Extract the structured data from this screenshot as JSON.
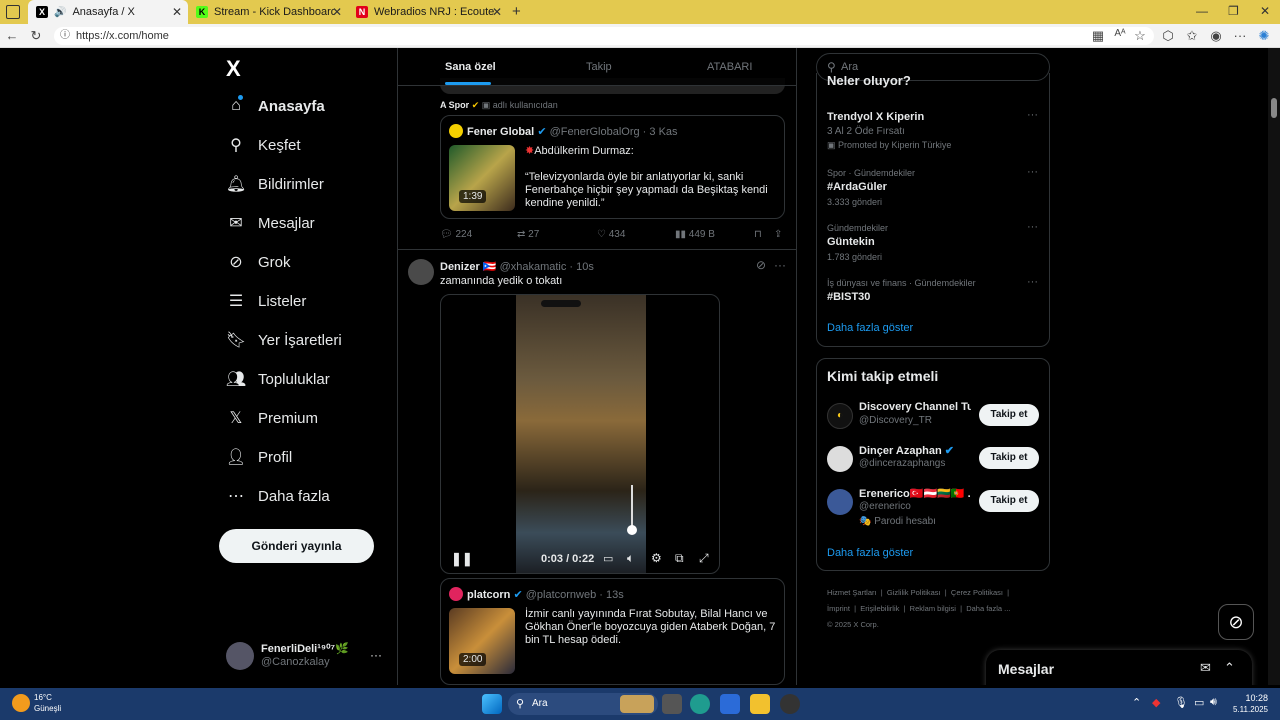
{
  "browser": {
    "tabs": [
      {
        "title": "Anasayfa / X",
        "fav": "X"
      },
      {
        "title": "Stream - Kick Dashboard",
        "fav": "K"
      },
      {
        "title": "Webradios NRJ : Ecoute en direct",
        "fav": "N"
      }
    ],
    "new_tab": "+",
    "url": "https://x.com/home"
  },
  "nav": {
    "logo": "X",
    "items": [
      "Anasayfa",
      "Keşfet",
      "Bildirimler",
      "Mesajlar",
      "Grok",
      "Listeler",
      "Yer İşaretleri",
      "Topluluklar",
      "Premium",
      "Profil",
      "Daha fazla"
    ],
    "post_button": "Gönderi yayınla",
    "account_name": "FenerliDeli¹⁹⁰⁷🌿",
    "account_handle": "@Canozkalay",
    "account_more": "···"
  },
  "timeline": {
    "tabs": [
      "Sana özel",
      "Takip",
      "ATABARI"
    ],
    "quote_label_name": "A Spor",
    "quote_label_rest": "adlı kullanıcıdan",
    "quote1": {
      "name": "Fener Global",
      "handle": "@FenerGlobalOrg · 3 Kas",
      "line1": "Abdülkerim Durmaz:",
      "line2": "“Televizyonlarda öyle bir anlatıyorlar ki, sanki Fenerbahçe hiçbir şey yapmadı da Beşiktaş kendi kendine yenildi.”",
      "duration": "1:39"
    },
    "actions": {
      "replies": "224",
      "reposts": "27",
      "likes": "434",
      "views": "449 B"
    },
    "post2": {
      "name": "Denizer",
      "handle": "@xhakamatic · 10s",
      "text": "zamanında yedik o tokatı",
      "video_time": "0:03 / 0:22"
    },
    "quote2": {
      "name": "platcorn",
      "handle": "@platcornweb · 13s",
      "text": "İzmir canlı yayınında Fırat Sobutay, Bilal Hancı ve Gökhan Öner'le boyozcuya giden Ataberk Doğan, 7 bin TL hesap ödedi.",
      "duration": "2:00"
    }
  },
  "sidebar": {
    "search_placeholder": "Ara",
    "trends_title": "Neler oluyor?",
    "trends": [
      {
        "meta": "",
        "title": "Trendyol X Kiperin",
        "sub": "3 Al 2 Öde Fırsatı",
        "promo": "Promoted by Kiperin Türkiye"
      },
      {
        "meta": "Spor · Gündemdekiler",
        "title": "#ArdaGüler",
        "sub": "3.333 gönderi",
        "promo": ""
      },
      {
        "meta": "Gündemdekiler",
        "title": "Güntekin",
        "sub": "1.783 gönderi",
        "promo": ""
      },
      {
        "meta": "İş dünyası ve finans · Gündemdekiler",
        "title": "#BIST30",
        "sub": "",
        "promo": ""
      }
    ],
    "show_more": "Daha fazla göster",
    "who_title": "Kimi takip etmeli",
    "who": [
      {
        "name": "Discovery Channel Tu...",
        "handle": "@Discovery_TR",
        "extra": ""
      },
      {
        "name": "Dinçer Azaphan",
        "handle": "@dincerazaphangs",
        "extra": ""
      },
      {
        "name": "Erenerico🇹🇷🇦🇹🇱🇹🇵🇹 ...",
        "handle": "@erenerico",
        "extra": "🎭 Parodi hesabı"
      }
    ],
    "follow_label": "Takip et",
    "show_more2": "Daha fazla göster",
    "footer_line1": "Hizmet Şartları  |  Gizlilik Politikası  |  Çerez Politikası  |",
    "footer_line2": "İmprint  |  Erişilebilirlik  |  Reklam bilgisi  |  Daha fazla ...",
    "footer_line3": "© 2025 X Corp.",
    "messages": "Mesajlar"
  },
  "taskbar": {
    "temp": "16°C",
    "weather": "Güneşli",
    "search": "Ara",
    "time": "10:28",
    "date": "5.11.2025"
  },
  "colors": {
    "accent": "#1d9bf0",
    "tabbar": "#e3c94f",
    "taskbar": "#1b3a6b"
  }
}
